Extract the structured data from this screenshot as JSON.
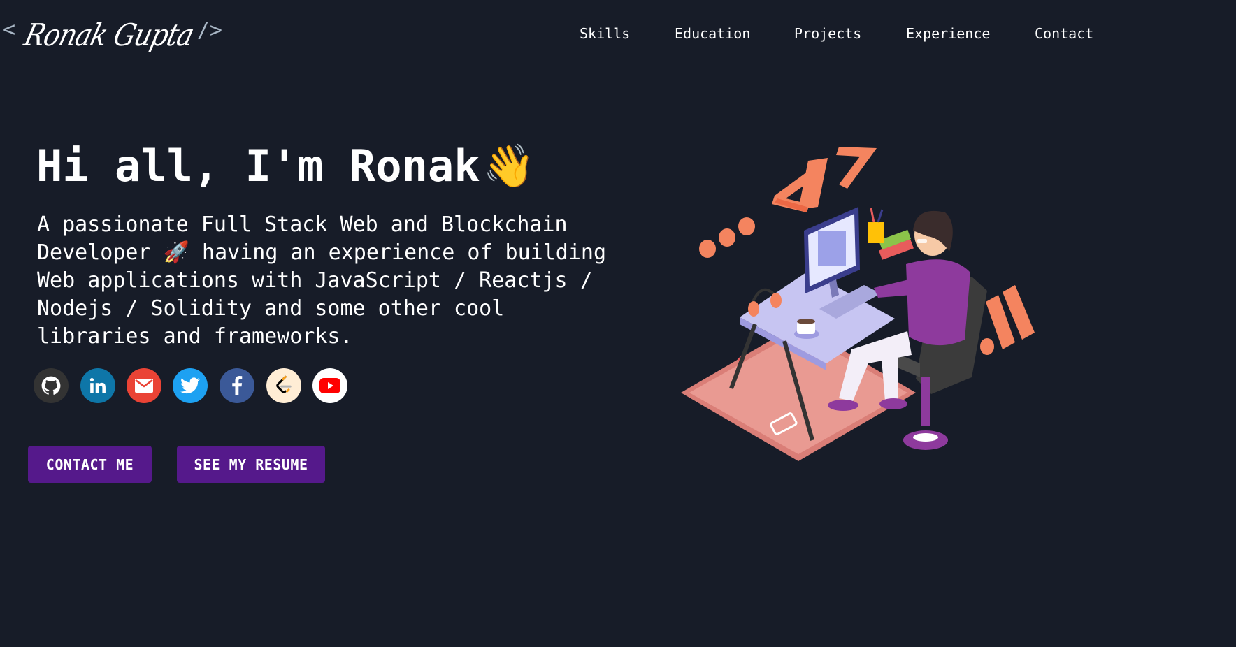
{
  "header": {
    "logo": {
      "open_bracket": "<",
      "signature": "Ronak Gupta",
      "close_bracket": "/>"
    },
    "nav": [
      {
        "label": "Skills"
      },
      {
        "label": "Education"
      },
      {
        "label": "Projects"
      },
      {
        "label": "Experience"
      },
      {
        "label": "Contact"
      }
    ]
  },
  "hero": {
    "title": "Hi all, I'm Ronak",
    "title_emoji": "👋",
    "subtitle": "A passionate Full Stack Web and Blockchain Developer 🚀 having an experience of building Web applications with JavaScript / Reactjs / Nodejs / Solidity and some other cool libraries and frameworks.",
    "socials": [
      {
        "icon": "github-icon",
        "color": "#333333"
      },
      {
        "icon": "linkedin-icon",
        "color": "#0e76a8"
      },
      {
        "icon": "gmail-icon",
        "color": "#ea4335"
      },
      {
        "icon": "twitter-icon",
        "color": "#1da1f2"
      },
      {
        "icon": "facebook-icon",
        "color": "#3b5998"
      },
      {
        "icon": "leetcode-icon",
        "color": "#ffedd5"
      },
      {
        "icon": "youtube-icon",
        "color": "#ffffff"
      }
    ],
    "buttons": {
      "contact": "CONTACT ME",
      "resume": "SEE MY RESUME"
    }
  },
  "colors": {
    "background": "#171c28",
    "button": "#55198b",
    "accent_orange": "#f4845f",
    "accent_purple": "#8e3a9d"
  }
}
